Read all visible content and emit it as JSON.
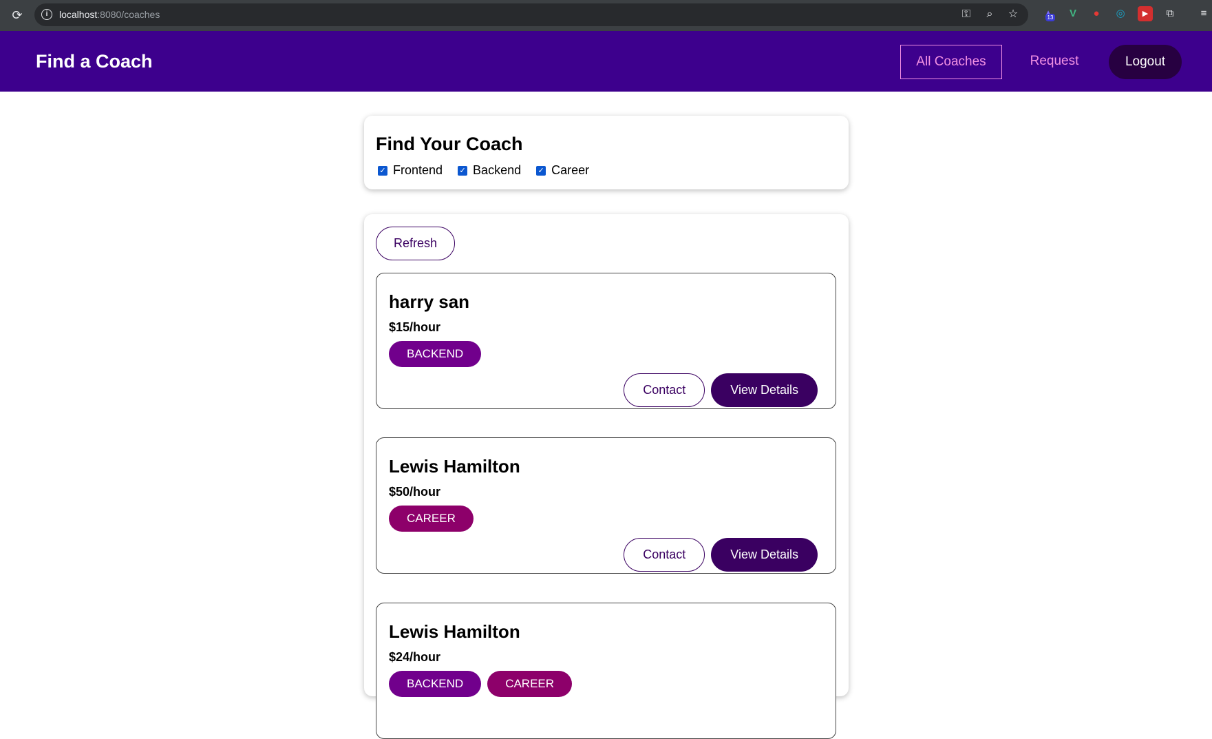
{
  "browser": {
    "url_host": "localhost",
    "url_rest": ":8080/coaches",
    "ext_badge": "13"
  },
  "header": {
    "brand": "Find a Coach",
    "nav": {
      "all_coaches": "All Coaches",
      "request": "Request",
      "logout": "Logout"
    }
  },
  "filter": {
    "title": "Find Your Coach",
    "options": [
      {
        "label": "Frontend",
        "checked": true
      },
      {
        "label": "Backend",
        "checked": true
      },
      {
        "label": "Career",
        "checked": true
      }
    ]
  },
  "list": {
    "refresh_label": "Refresh",
    "contact_label": "Contact",
    "details_label": "View Details",
    "coaches": [
      {
        "name": "harry san",
        "rate": "$15/hour",
        "areas": [
          "BACKEND"
        ]
      },
      {
        "name": "Lewis Hamilton",
        "rate": "$50/hour",
        "areas": [
          "CAREER"
        ]
      },
      {
        "name": "Lewis Hamilton",
        "rate": "$24/hour",
        "areas": [
          "BACKEND",
          "CAREER"
        ]
      }
    ]
  },
  "colors": {
    "header_bg": "#3d008d",
    "nav_accent": "#f391e3",
    "primary": "#3a0061",
    "badge_backend": "#71008c",
    "badge_career": "#8d006a"
  }
}
